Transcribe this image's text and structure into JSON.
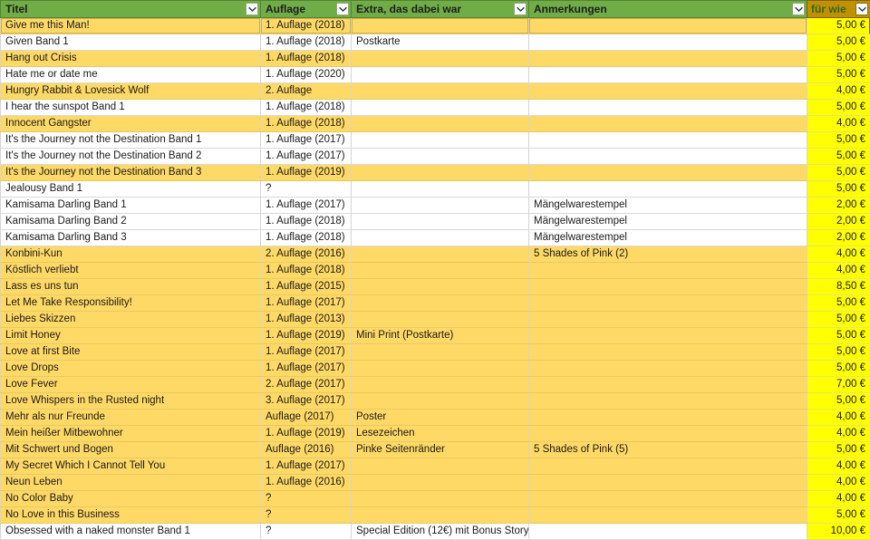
{
  "app": {
    "type": "spreadsheet-table",
    "header_bg": "#70AD47",
    "price_header_bg": "#BF9000",
    "highlight_bg": "#FFD966",
    "price_cell_bg": "#FFFF00"
  },
  "columns": [
    {
      "key": "titel",
      "label": "Titel",
      "filter_icon": "chevron-down-icon"
    },
    {
      "key": "auflage",
      "label": "Auflage",
      "filter_icon": "chevron-down-icon"
    },
    {
      "key": "extra",
      "label": "Extra, das dabei war",
      "filter_icon": "chevron-down-icon"
    },
    {
      "key": "anmerk",
      "label": "Anmerkungen",
      "filter_icon": "chevron-down-icon"
    },
    {
      "key": "preis",
      "label": "für wie",
      "filter_icon": "chevron-down-icon"
    }
  ],
  "rows": [
    {
      "titel": "Give me this Man!",
      "auflage": "1. Auflage (2018)",
      "extra": "",
      "anmerk": "",
      "preis": "5,00 €",
      "highlight": true
    },
    {
      "titel": "Given Band 1",
      "auflage": "1. Auflage (2018)",
      "extra": "Postkarte",
      "anmerk": "",
      "preis": "5,00 €",
      "highlight": false
    },
    {
      "titel": "Hang out Crisis",
      "auflage": "1. Auflage (2018)",
      "extra": "",
      "anmerk": "",
      "preis": "5,00 €",
      "highlight": true
    },
    {
      "titel": "Hate me or date me",
      "auflage": "1. Auflage (2020)",
      "extra": "",
      "anmerk": "",
      "preis": "5,00 €",
      "highlight": false
    },
    {
      "titel": "Hungry Rabbit & Lovesick Wolf",
      "auflage": "2. Auflage",
      "extra": "",
      "anmerk": "",
      "preis": "4,00 €",
      "highlight": true
    },
    {
      "titel": "I hear the sunspot Band 1",
      "auflage": "1. Auflage (2018)",
      "extra": "",
      "anmerk": "",
      "preis": "5,00 €",
      "highlight": false
    },
    {
      "titel": "Innocent Gangster",
      "auflage": "1. Auflage (2018)",
      "extra": "",
      "anmerk": "",
      "preis": "4,00 €",
      "highlight": true
    },
    {
      "titel": "It's the Journey not the Destination Band 1",
      "auflage": "1. Auflage (2017)",
      "extra": "",
      "anmerk": "",
      "preis": "5,00 €",
      "highlight": false
    },
    {
      "titel": "It's the Journey not the Destination Band 2",
      "auflage": "1. Auflage (2017)",
      "extra": "",
      "anmerk": "",
      "preis": "5,00 €",
      "highlight": false
    },
    {
      "titel": "It's the Journey not the Destination Band 3",
      "auflage": "1. Auflage (2019)",
      "extra": "",
      "anmerk": "",
      "preis": "5,00 €",
      "highlight": true
    },
    {
      "titel": "Jealousy Band 1",
      "auflage": "?",
      "extra": "",
      "anmerk": "",
      "preis": "5,00 €",
      "highlight": false
    },
    {
      "titel": "Kamisama Darling Band 1",
      "auflage": "1. Auflage (2017)",
      "extra": "",
      "anmerk": "Mängelwarestempel",
      "preis": "2,00 €",
      "highlight": false
    },
    {
      "titel": "Kamisama Darling Band 2",
      "auflage": "1. Auflage (2018)",
      "extra": "",
      "anmerk": "Mängelwarestempel",
      "preis": "2,00 €",
      "highlight": false
    },
    {
      "titel": "Kamisama Darling Band 3",
      "auflage": "1. Auflage (2018)",
      "extra": "",
      "anmerk": "Mängelwarestempel",
      "preis": "2,00 €",
      "highlight": false
    },
    {
      "titel": "Konbini-Kun",
      "auflage": "2. Auflage (2016)",
      "extra": "",
      "anmerk": "5 Shades of Pink (2)",
      "preis": "4,00 €",
      "highlight": true
    },
    {
      "titel": "Köstlich verliebt",
      "auflage": "1. Auflage (2018)",
      "extra": "",
      "anmerk": "",
      "preis": "4,00 €",
      "highlight": true
    },
    {
      "titel": "Lass es uns tun",
      "auflage": "1. Auflage (2015)",
      "extra": "",
      "anmerk": "",
      "preis": "8,50 €",
      "highlight": true
    },
    {
      "titel": "Let Me Take Responsibility!",
      "auflage": "1. Auflage (2017)",
      "extra": "",
      "anmerk": "",
      "preis": "5,00 €",
      "highlight": true
    },
    {
      "titel": "Liebes Skizzen",
      "auflage": "1. Auflage (2013)",
      "extra": "",
      "anmerk": "",
      "preis": "5,00 €",
      "highlight": true
    },
    {
      "titel": "Limit Honey",
      "auflage": "1. Auflage (2019)",
      "extra": "Mini Print (Postkarte)",
      "anmerk": "",
      "preis": "5,00 €",
      "highlight": true
    },
    {
      "titel": "Love at first Bite",
      "auflage": "1. Auflage (2017)",
      "extra": "",
      "anmerk": "",
      "preis": "5,00 €",
      "highlight": true
    },
    {
      "titel": "Love Drops",
      "auflage": "1. Auflage (2017)",
      "extra": "",
      "anmerk": "",
      "preis": "5,00 €",
      "highlight": true
    },
    {
      "titel": "Love Fever",
      "auflage": "2. Auflage (2017)",
      "extra": "",
      "anmerk": "",
      "preis": "7,00 €",
      "highlight": true
    },
    {
      "titel": "Love Whispers in the Rusted night",
      "auflage": "3. Auflage (2017)",
      "extra": "",
      "anmerk": "",
      "preis": "5,00 €",
      "highlight": true
    },
    {
      "titel": "Mehr als nur Freunde",
      "auflage": "Auflage (2017)",
      "extra": "Poster",
      "anmerk": "",
      "preis": "4,00 €",
      "highlight": true
    },
    {
      "titel": "Mein heißer Mitbewohner",
      "auflage": "1. Auflage (2019)",
      "extra": "Lesezeichen",
      "anmerk": "",
      "preis": "4,00 €",
      "highlight": true
    },
    {
      "titel": "Mit Schwert und Bogen",
      "auflage": "Auflage (2016)",
      "extra": "Pinke Seitenränder",
      "anmerk": "5 Shades of Pink (5)",
      "preis": "5,00 €",
      "highlight": true
    },
    {
      "titel": "My Secret Which I Cannot Tell You",
      "auflage": "1. Auflage (2017)",
      "extra": "",
      "anmerk": "",
      "preis": "4,00 €",
      "highlight": true
    },
    {
      "titel": "Neun Leben",
      "auflage": "1. Auflage (2016)",
      "extra": "",
      "anmerk": "",
      "preis": "4,00 €",
      "highlight": true
    },
    {
      "titel": "No Color Baby",
      "auflage": "?",
      "extra": "",
      "anmerk": "",
      "preis": "4,00 €",
      "highlight": true
    },
    {
      "titel": "No Love in this Business",
      "auflage": "?",
      "extra": "",
      "anmerk": "",
      "preis": "5,00 €",
      "highlight": true
    },
    {
      "titel": "Obsessed with a naked monster Band 1",
      "auflage": "?",
      "extra": "Special Edition (12€) mit Bonus Story",
      "anmerk": "",
      "preis": "10,00 €",
      "highlight": false
    }
  ]
}
